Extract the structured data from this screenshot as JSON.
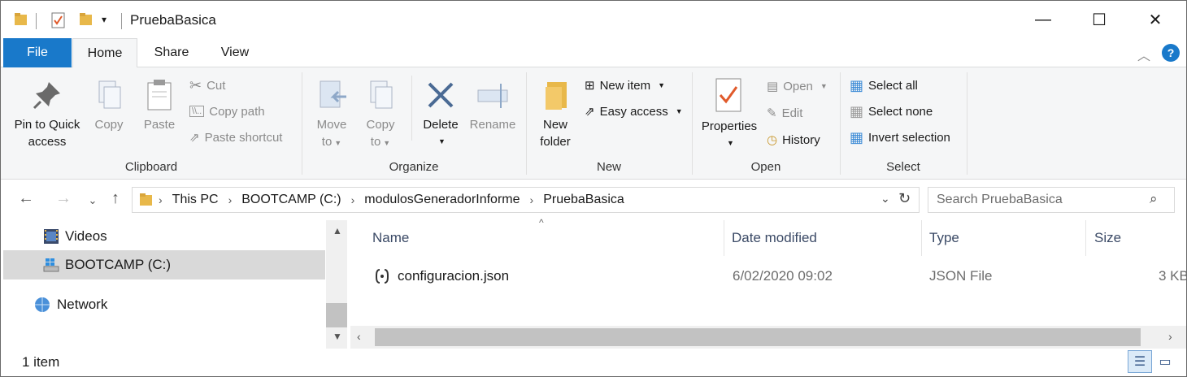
{
  "window": {
    "title": "PruebaBasica",
    "controls": {
      "minimize": "—",
      "maximize": "☐",
      "close": "✕"
    }
  },
  "tabs": [
    "File",
    "Home",
    "Share",
    "View"
  ],
  "ribbon": {
    "clipboard": {
      "group_label": "Clipboard",
      "pin_line1": "Pin to Quick",
      "pin_line2": "access",
      "copy": "Copy",
      "paste": "Paste",
      "cut": "Cut",
      "copy_path": "Copy path",
      "paste_shortcut": "Paste shortcut"
    },
    "organize": {
      "group_label": "Organize",
      "move_line1": "Move",
      "move_line2": "to",
      "copy_line1": "Copy",
      "copy_line2": "to",
      "delete": "Delete",
      "rename": "Rename"
    },
    "new": {
      "group_label": "New",
      "new_folder_line1": "New",
      "new_folder_line2": "folder",
      "new_item": "New item",
      "easy_access": "Easy access"
    },
    "open": {
      "group_label": "Open",
      "properties": "Properties",
      "open": "Open",
      "edit": "Edit",
      "history": "History"
    },
    "select": {
      "group_label": "Select",
      "select_all": "Select all",
      "select_none": "Select none",
      "invert_selection": "Invert selection"
    }
  },
  "address": {
    "crumbs": [
      "This PC",
      "BOOTCAMP (C:)",
      "modulosGeneradorInforme",
      "PruebaBasica"
    ],
    "search_placeholder": "Search PruebaBasica"
  },
  "nav_pane": {
    "items": [
      "Videos",
      "BOOTCAMP (C:)",
      "Network"
    ]
  },
  "columns": [
    "Name",
    "Date modified",
    "Type",
    "Size"
  ],
  "files": [
    {
      "name": "configuracion.json",
      "date": "6/02/2020 09:02",
      "type": "JSON File",
      "size": "3 KB"
    }
  ],
  "status": {
    "count": "1 item"
  },
  "colors": {
    "accent": "#1979ca",
    "ribbon_bg": "#f5f6f7",
    "selected_bg": "#d9d9d9"
  }
}
